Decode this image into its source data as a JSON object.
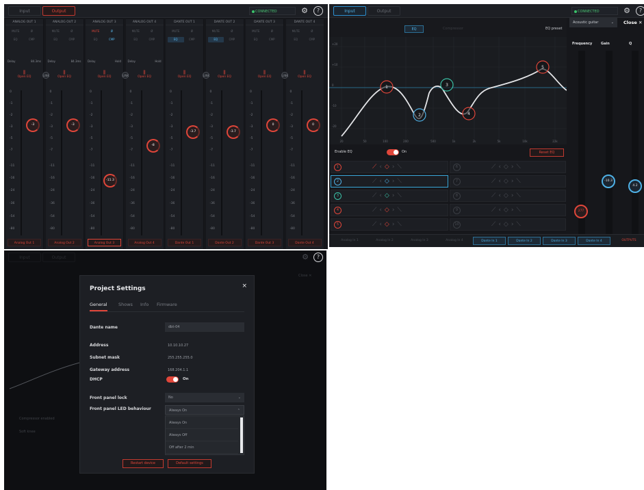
{
  "mixer": {
    "tabs": [
      "Input",
      "Output"
    ],
    "connected": "CONNECTED",
    "channels": [
      {
        "title": "ANALOG OUT 1",
        "row1": [
          "MUTE",
          "Ø"
        ],
        "row2": [
          "EQ",
          "CMP"
        ],
        "delay_label": "Delay",
        "delay": "84.3ms",
        "open_eq": "Open EQ",
        "knob": "-3",
        "footer": "Analog Out 1"
      },
      {
        "title": "ANALOG OUT 2",
        "row1": [
          "MUTE",
          "Ø"
        ],
        "row2": [
          "EQ",
          "CMP"
        ],
        "delay_label": "Delay",
        "delay": "84.3ms",
        "open_eq": "Open EQ",
        "knob": "-3",
        "footer": "Analog Out 2"
      },
      {
        "title": "ANALOG OUT 3",
        "row1": [
          "MUTE",
          "Ø"
        ],
        "row2": [
          "EQ",
          "CMP"
        ],
        "delay_label": "Delay",
        "delay": "Hold",
        "open_eq": "Open EQ",
        "knob": "-11.3",
        "footer": "Analog Out 3"
      },
      {
        "title": "ANALOG OUT 4",
        "row1": [
          "MUTE",
          "Ø"
        ],
        "row2": [
          "EQ",
          "CMP"
        ],
        "delay_label": "Delay",
        "delay": "Hold",
        "open_eq": "Open EQ",
        "knob": "-8",
        "footer": "Analog Out 4"
      },
      {
        "title": "DANTE OUT 1",
        "row1": [
          "MUTE",
          "Ø"
        ],
        "row2": [
          "EQ",
          "CMP"
        ],
        "delay_label": "",
        "delay": "",
        "open_eq": "Open EQ",
        "knob": "-3.7",
        "footer": "Dante Out 1"
      },
      {
        "title": "DANTE OUT 2",
        "row1": [
          "MUTE",
          "Ø"
        ],
        "row2": [
          "EQ",
          "CMP"
        ],
        "delay_label": "",
        "delay": "",
        "open_eq": "Open EQ",
        "knob": "-3.7",
        "footer": "Dante Out 2"
      },
      {
        "title": "DANTE OUT 3",
        "row1": [
          "MUTE",
          "Ø"
        ],
        "row2": [
          "EQ",
          "CMP"
        ],
        "delay_label": "",
        "delay": "",
        "open_eq": "Open EQ",
        "knob": "0",
        "footer": "Dante Out 3"
      },
      {
        "title": "DANTE OUT 4",
        "row1": [
          "MUTE",
          "Ø"
        ],
        "row2": [
          "EQ",
          "CMP"
        ],
        "delay_label": "",
        "delay": "",
        "open_eq": "Open EQ",
        "knob": "0",
        "footer": "Dante Out 4"
      }
    ],
    "link_labels": [
      "LINK",
      "LINK",
      "LINK",
      "LINK"
    ],
    "scale": [
      "0",
      "-1",
      "-2",
      "-3",
      "-5",
      "-7",
      "-11",
      "-16",
      "-24",
      "-36",
      "-54",
      "-80"
    ]
  },
  "eq": {
    "tabs": [
      "Input",
      "Output"
    ],
    "connected": "CONNECTED",
    "subtabs": [
      "EQ",
      "Compressor"
    ],
    "eq_preset_label": "EQ preset",
    "eq_preset_value": "Acoustic guitar",
    "close": "Close ✕",
    "y_labels": [
      "+20",
      "+10",
      "0",
      "-10",
      "-20"
    ],
    "x_labels": [
      "20",
      "50",
      "100",
      "200",
      "500",
      "1k",
      "2k",
      "5k",
      "10k",
      "22k"
    ],
    "enable_label": "Enable EQ",
    "enable_state": "On",
    "reset": "Reset EQ",
    "bands": [
      {
        "num": "1",
        "color": "#e0463a"
      },
      {
        "num": "2",
        "color": "#4fb1e6"
      },
      {
        "num": "3",
        "color": "#3bc2a7"
      },
      {
        "num": "4",
        "color": "#e0463a"
      },
      {
        "num": "5",
        "color": "#e0463a"
      }
    ],
    "right_bands": [
      "6",
      "7",
      "8",
      "9",
      "10"
    ],
    "side_headers": [
      "Frequency",
      "Gain",
      "Q"
    ],
    "freq_knob": "277",
    "gain_knob": "-10.3",
    "q_knob": "4.2",
    "bottom_tabs": [
      "Analog In 1",
      "Analog In 2",
      "Analog In 3",
      "Analog In 4",
      "Dante In 1",
      "Dante In 2",
      "Dante In 3",
      "Dante In 4",
      "OUTPUTS"
    ]
  },
  "settings": {
    "title": "Project Settings",
    "close": "×",
    "tabs": [
      "General",
      "Shows",
      "Info",
      "Firmware"
    ],
    "dante_name_label": "Dante name",
    "dante_name_value": "dbt-04",
    "address_label": "Address",
    "address_value": "10.10.10.27",
    "subnet_label": "Subnet mask",
    "subnet_value": "255.255.255.0",
    "gateway_label": "Gateway address",
    "gateway_value": "168.204.1.1",
    "dhcp_label": "DHCP",
    "dhcp_state": "On",
    "panel_lock_label": "Front panel lock",
    "panel_lock_value": "No",
    "led_label": "Front panel LED behaviour",
    "led_value": "Always On",
    "led_options": [
      "Always On",
      "Always Off",
      "Off after 2 min"
    ],
    "restart": "Restart device",
    "default": "Default settings",
    "bg_labels": [
      "Compressor enabled",
      "Soft knee",
      "Close ✕"
    ]
  }
}
